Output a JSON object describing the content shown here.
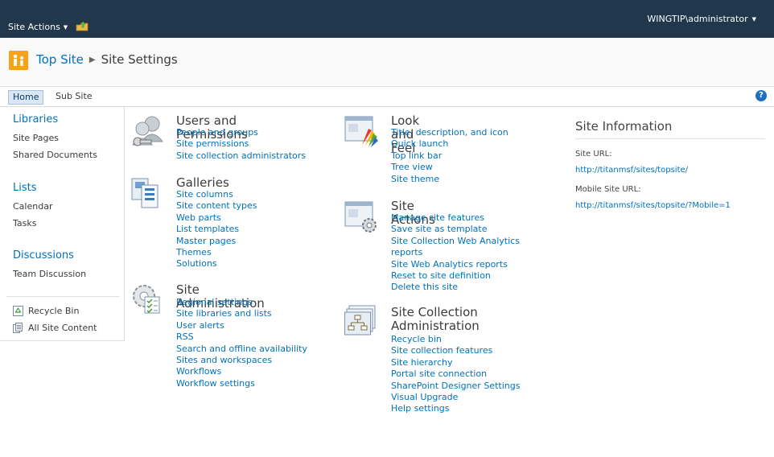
{
  "topbar": {
    "site_actions_label": "Site Actions",
    "user_label": "WINGTIP\\administrator"
  },
  "titlearea": {
    "breadcrumb_home": "Top Site",
    "breadcrumb_current": "Site Settings"
  },
  "topnav": {
    "tabs": [
      "Home",
      "Sub Site"
    ],
    "help": "?"
  },
  "leftnav": {
    "sections": [
      {
        "heading": "Libraries",
        "items": [
          "Site Pages",
          "Shared Documents"
        ]
      },
      {
        "heading": "Lists",
        "items": [
          "Calendar",
          "Tasks"
        ]
      },
      {
        "heading": "Discussions",
        "items": [
          "Team Discussion"
        ]
      }
    ],
    "recycle_bin": "Recycle Bin",
    "all_site_content": "All Site Content"
  },
  "groups": {
    "users_permissions": {
      "title": "Users and Permissions",
      "links": [
        "People and groups",
        "Site permissions",
        "Site collection administrators"
      ]
    },
    "galleries": {
      "title": "Galleries",
      "links": [
        "Site columns",
        "Site content types",
        "Web parts",
        "List templates",
        "Master pages",
        "Themes",
        "Solutions"
      ]
    },
    "site_administration": {
      "title": "Site Administration",
      "links": [
        "Regional settings",
        "Site libraries and lists",
        "User alerts",
        "RSS",
        "Search and offline availability",
        "Sites and workspaces",
        "Workflows",
        "Workflow settings"
      ]
    },
    "look_and_feel": {
      "title": "Look and Feel",
      "links": [
        "Title, description, and icon",
        "Quick launch",
        "Top link bar",
        "Tree view",
        "Site theme"
      ]
    },
    "site_actions": {
      "title": "Site Actions",
      "links": [
        "Manage site features",
        "Save site as template",
        "Site Collection Web Analytics",
        "reports",
        "Site Web Analytics reports",
        "Reset to site definition",
        "Delete this site"
      ]
    },
    "site_collection_admin": {
      "title_line1": "Site Collection",
      "title_line2": "Administration",
      "links": [
        "Recycle bin",
        "Site collection features",
        "Site hierarchy",
        "Portal site connection",
        "SharePoint Designer Settings",
        "Visual Upgrade",
        "Help settings"
      ]
    }
  },
  "site_info": {
    "title": "Site Information",
    "site_url_label": "Site URL:",
    "site_url": "http://titanmsf/sites/topsite/",
    "mobile_url_label": "Mobile Site URL:",
    "mobile_url": "http://titanmsf/sites/topsite/?Mobile=1"
  },
  "colors": {
    "topbar": "#21374c",
    "link": "#0072bc",
    "logo": "#f7a21a"
  }
}
